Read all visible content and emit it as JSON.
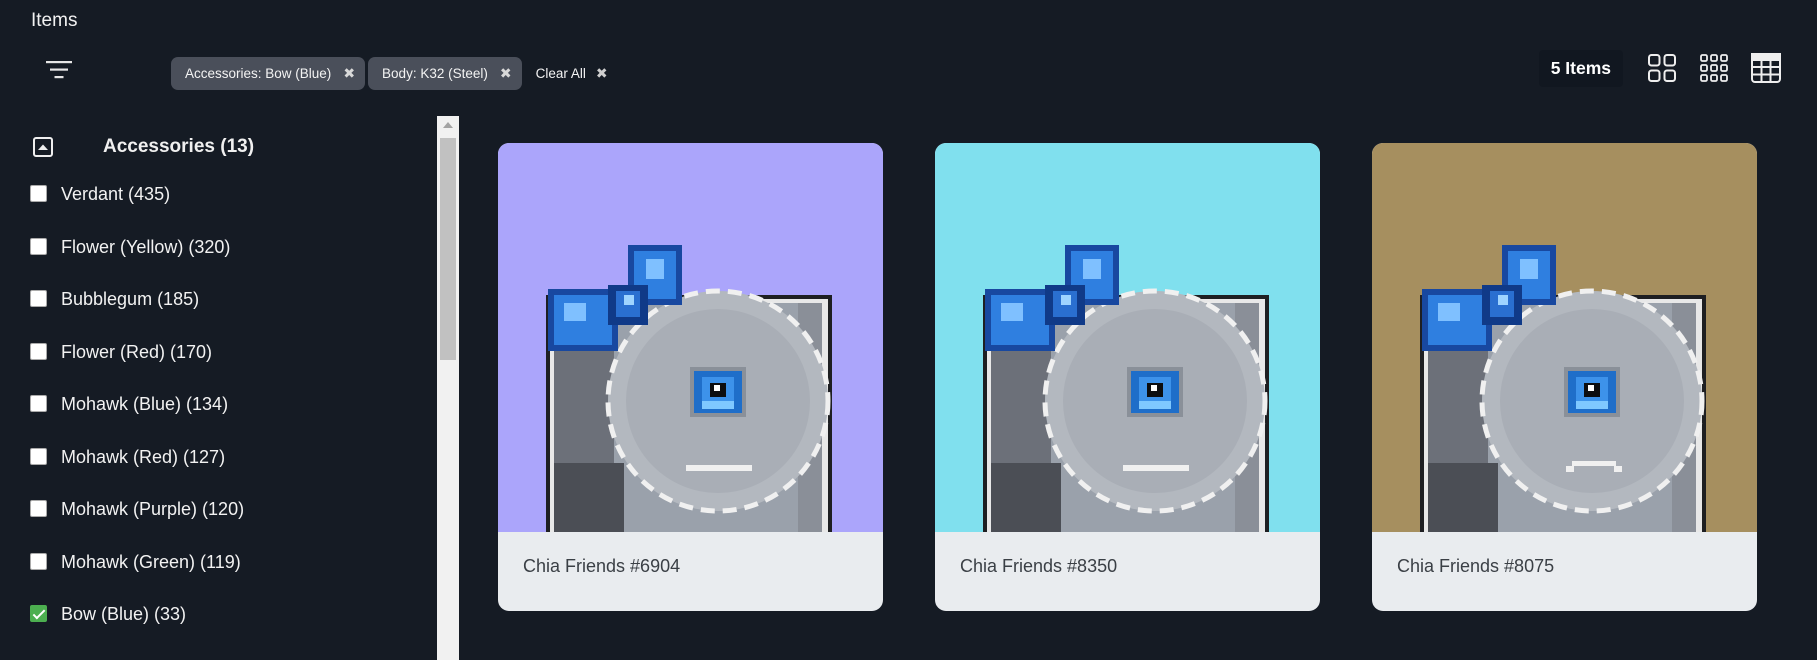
{
  "page": {
    "title": "Items"
  },
  "toolbar": {
    "filter_icon": "filter-lines-icon",
    "active_filters": [
      {
        "label": "Accessories: Bow (Blue)"
      },
      {
        "label": "Body: K32 (Steel)"
      }
    ],
    "remove_icon": "✖",
    "clear_all_label": "Clear All",
    "items_count": "5 Items",
    "view_modes": [
      "grid-large-icon",
      "grid-small-icon",
      "table-icon"
    ]
  },
  "sidebar": {
    "section_title": "Accessories (13)",
    "traits": [
      {
        "label": "Verdant (435)",
        "checked": false
      },
      {
        "label": "Flower (Yellow) (320)",
        "checked": false
      },
      {
        "label": "Bubblegum (185)",
        "checked": false
      },
      {
        "label": "Flower (Red) (170)",
        "checked": false
      },
      {
        "label": "Mohawk (Blue) (134)",
        "checked": false
      },
      {
        "label": "Mohawk (Red) (127)",
        "checked": false
      },
      {
        "label": "Mohawk (Purple) (120)",
        "checked": false
      },
      {
        "label": "Mohawk (Green) (119)",
        "checked": false
      },
      {
        "label": "Bow (Blue) (33)",
        "checked": true
      }
    ]
  },
  "cards": [
    {
      "name": "Chia Friends #6904",
      "background": "#aba5fb",
      "mouth": "flat"
    },
    {
      "name": "Chia Friends #8350",
      "background": "#80e0ee",
      "mouth": "flat"
    },
    {
      "name": "Chia Friends #8075",
      "background": "#a68f5f",
      "mouth": "frown"
    }
  ],
  "colors": {
    "page_bg": "#151b24",
    "chip_bg": "#4a4f5a",
    "card_footer": "#e9ecef",
    "checkbox_checked": "#4caf50"
  }
}
